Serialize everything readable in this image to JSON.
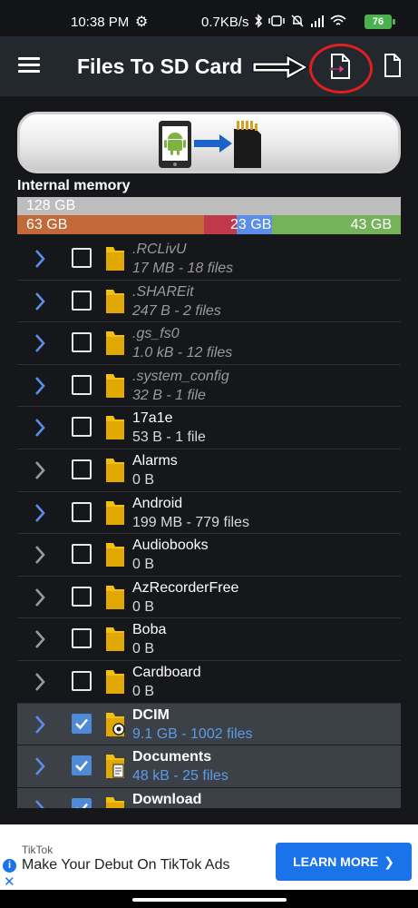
{
  "status": {
    "time": "10:38 PM",
    "speed": "0.7KB/s",
    "battery": "76",
    "icons": [
      "settings-icon",
      "bluetooth-icon",
      "vibrate-icon",
      "mute-icon",
      "signal-icon",
      "wifi-icon"
    ]
  },
  "appbar": {
    "title": "Files To SD Card"
  },
  "memory": {
    "label": "Internal memory",
    "total": "128 GB",
    "segments": [
      "63 GB",
      "23 GB",
      "43 GB"
    ]
  },
  "folders": [
    {
      "name": ".RCLivU",
      "meta": "17 MB - 18 files"
    },
    {
      "name": ".SHAREit",
      "meta": "247 B - 2 files"
    },
    {
      "name": ".gs_fs0",
      "meta": "1.0 kB - 12 files"
    },
    {
      "name": ".system_config",
      "meta": "32 B - 1 file"
    },
    {
      "name": "17a1e",
      "meta": "53 B - 1 file"
    },
    {
      "name": "Alarms",
      "meta": "0 B"
    },
    {
      "name": "Android",
      "meta": "199 MB - 779 files"
    },
    {
      "name": "Audiobooks",
      "meta": "0 B"
    },
    {
      "name": "AzRecorderFree",
      "meta": "0 B"
    },
    {
      "name": "Boba",
      "meta": "0 B"
    },
    {
      "name": "Cardboard",
      "meta": "0 B"
    },
    {
      "name": "DCIM",
      "meta": "9.1 GB - 1002 files"
    },
    {
      "name": "Documents",
      "meta": "48 kB - 25 files"
    },
    {
      "name": "Download",
      "meta": ""
    }
  ],
  "colors": {
    "accent": "#4f8ad6",
    "annotation": "#e01f1f",
    "folder": "#f2c10f"
  },
  "ad": {
    "brand": "TikTok",
    "title": "Make Your Debut On TikTok Ads",
    "button": "LEARN MORE"
  }
}
